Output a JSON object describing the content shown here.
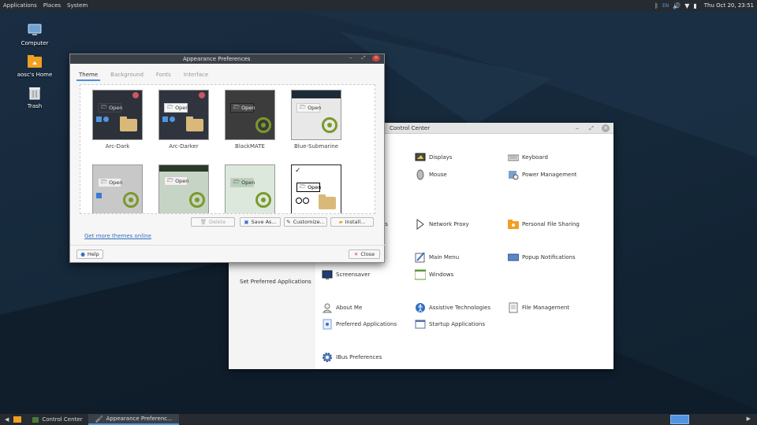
{
  "topbar": {
    "menus": [
      "Applications",
      "Places",
      "System"
    ],
    "keyboard_layout": "EN",
    "clock": "Thu Oct 20, 23:51"
  },
  "desktop_icons": [
    {
      "label": "Computer",
      "icon": "computer-icon"
    },
    {
      "label": "aosc's Home",
      "icon": "home-folder-icon"
    },
    {
      "label": "Trash",
      "icon": "trash-icon"
    }
  ],
  "control_center": {
    "title": "Control Center",
    "sidebar_item": "Set Preferred Applications",
    "items": [
      {
        "label": "Displays",
        "icon": "display-icon"
      },
      {
        "label": "Keyboard",
        "icon": "keyboard-icon"
      },
      {
        "label": "Mouse",
        "icon": "mouse-icon"
      },
      {
        "label": "Power Management",
        "icon": "power-icon"
      },
      {
        "label": "Network Proxy",
        "icon": "network-icon"
      },
      {
        "label": "Personal File Sharing",
        "icon": "sharing-folder-icon"
      },
      {
        "label": "Main Menu",
        "icon": "menu-editor-icon"
      },
      {
        "label": "Popup Notifications",
        "icon": "notification-icon"
      },
      {
        "label": "Screensaver",
        "icon": "screensaver-icon"
      },
      {
        "label": "Windows",
        "icon": "windows-icon"
      },
      {
        "label": "About Me",
        "icon": "user-icon"
      },
      {
        "label": "Assistive Technologies",
        "icon": "accessibility-icon"
      },
      {
        "label": "File Management",
        "icon": "file-icon"
      },
      {
        "label": "Preferred Applications",
        "icon": "preferred-apps-icon"
      },
      {
        "label": "Startup Applications",
        "icon": "startup-icon"
      },
      {
        "label": "IBus Preferences",
        "icon": "ibus-gear-icon"
      }
    ],
    "partial_label": "es"
  },
  "appearance": {
    "title": "Appearance Preferences",
    "tabs": [
      "Theme",
      "Background",
      "Fonts",
      "Interface"
    ],
    "active_tab": "Theme",
    "themes": [
      "Arc-Dark",
      "Arc-Darker",
      "BlackMATE",
      "Blue-Submarine",
      "",
      "",
      "",
      ""
    ],
    "thumb_open": "Open",
    "buttons": {
      "delete": "Delete",
      "save_as": "Save As...",
      "customize": "Customize...",
      "install": "Install..."
    },
    "more_link": "Get more themes online",
    "help": "Help",
    "close": "Close"
  },
  "taskbar": {
    "tasks": [
      "Control Center",
      "Appearance Preferenc..."
    ]
  }
}
